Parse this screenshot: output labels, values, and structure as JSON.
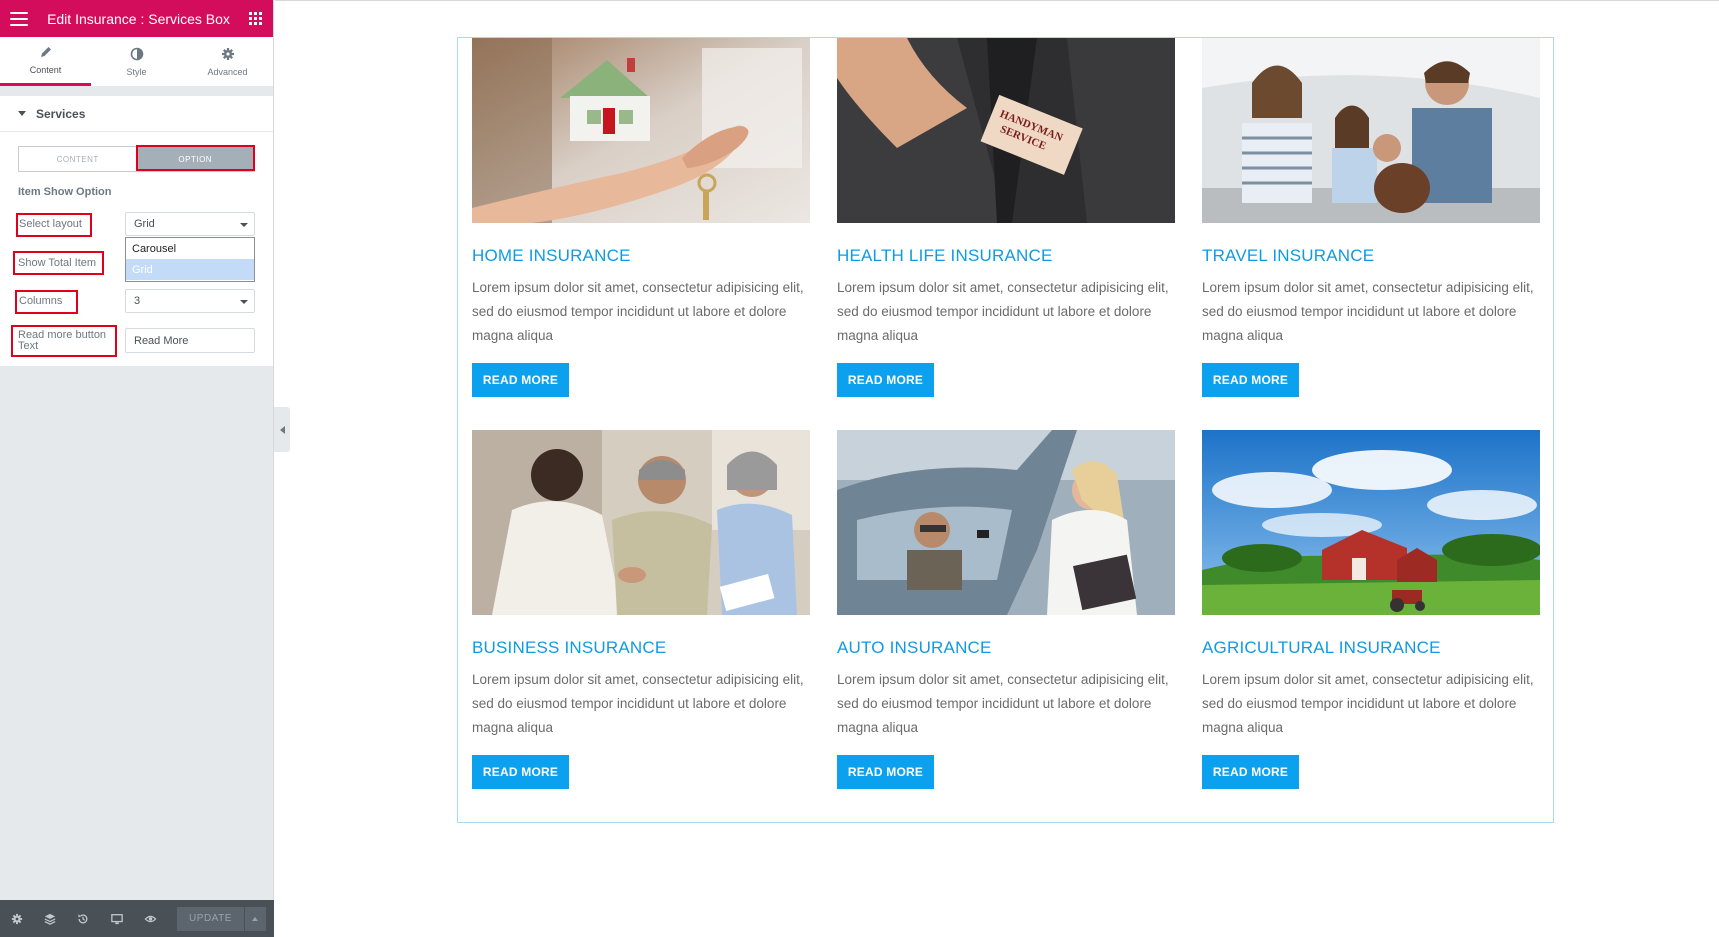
{
  "editor": {
    "title": "Edit Insurance : Services Box",
    "tabs": [
      {
        "label": "Content",
        "icon": "pencil-icon"
      },
      {
        "label": "Style",
        "icon": "half-circle-icon"
      },
      {
        "label": "Advanced",
        "icon": "gear-icon"
      }
    ],
    "section_title": "Services",
    "toggle": {
      "content": "CONTENT",
      "option": "OPTION"
    },
    "item_show_option": "Item Show Option",
    "controls": {
      "select_layout_label": "Select layout",
      "select_layout_value": "Grid",
      "layout_options": [
        "Carousel",
        "Grid"
      ],
      "show_total_item_label": "Show Total Item",
      "columns_label": "Columns",
      "columns_value": "3",
      "read_more_label": "Read more button Text",
      "read_more_value": "Read More"
    },
    "footer": {
      "update_label": "UPDATE"
    }
  },
  "services": [
    {
      "title": "HOME INSURANCE",
      "text": "Lorem ipsum dolor sit amet, consectetur adipisicing elit, sed do eiusmod tempor incididunt ut labore et dolore magna aliqua",
      "button": "READ MORE",
      "image": "house-in-hand-photo"
    },
    {
      "title": "HEALTH LIFE INSURANCE",
      "text": "Lorem ipsum dolor sit amet, consectetur adipisicing elit, sed do eiusmod tempor incididunt ut labore et dolore magna aliqua",
      "button": "READ MORE",
      "image": "handyman-service-card-photo",
      "image_text": "HANDYMAN SERVICE"
    },
    {
      "title": "TRAVEL INSURANCE",
      "text": "Lorem ipsum dolor sit amet, consectetur adipisicing elit, sed do eiusmod tempor incididunt ut labore et dolore magna aliqua",
      "button": "READ MORE",
      "image": "family-in-car-photo"
    },
    {
      "title": "BUSINESS INSURANCE",
      "text": "Lorem ipsum dolor sit amet, consectetur adipisicing elit, sed do eiusmod tempor incididunt ut labore et dolore magna aliqua",
      "button": "READ MORE",
      "image": "handshake-meeting-photo"
    },
    {
      "title": "AUTO INSURANCE",
      "text": "Lorem ipsum dolor sit amet, consectetur adipisicing elit, sed do eiusmod tempor incididunt ut labore et dolore magna aliqua",
      "button": "READ MORE",
      "image": "car-keys-handover-photo"
    },
    {
      "title": "AGRICULTURAL INSURANCE",
      "text": "Lorem ipsum dolor sit amet, consectetur adipisicing elit, sed do eiusmod tempor incididunt ut labore et dolore magna aliqua",
      "button": "READ MORE",
      "image": "farm-barn-tractor-photo"
    }
  ],
  "colors": {
    "brand": "#d30c5c",
    "accent": "#0ba1ef",
    "heading": "#0d9be5",
    "highlight": "#e0001b"
  }
}
